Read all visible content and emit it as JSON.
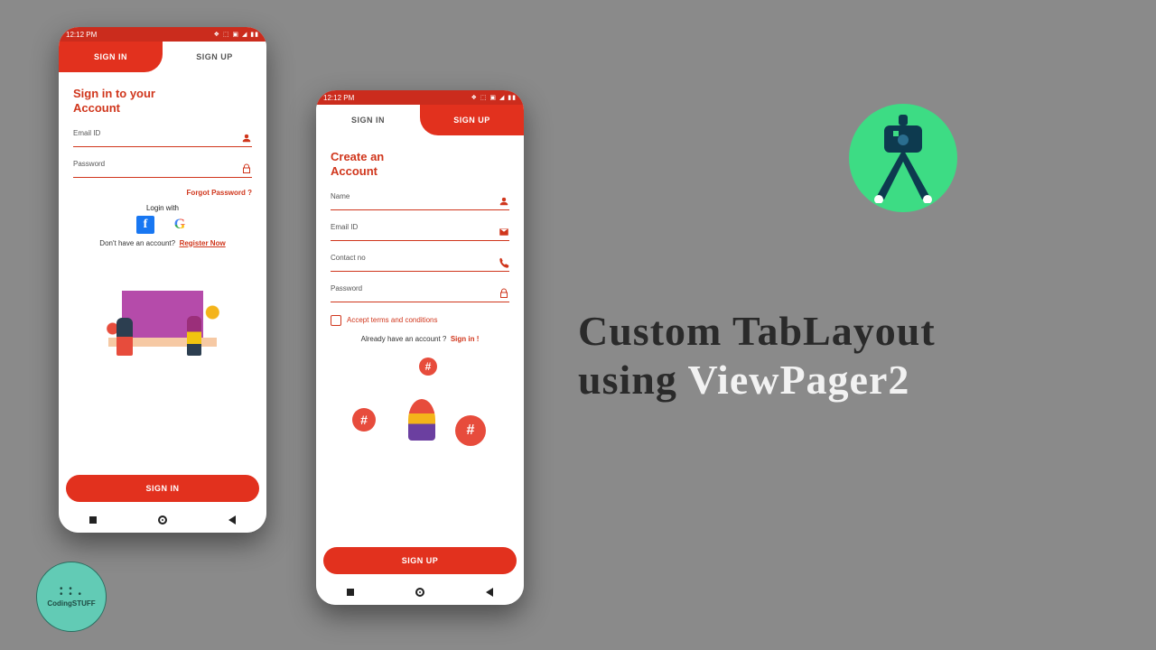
{
  "statusbar": {
    "time": "12:12 PM",
    "icons": "◆ ◉ ↕ ▲",
    "right": "❖ ⬚ ▣ ◢ ▮▮"
  },
  "tabs": {
    "signin": "SIGN IN",
    "signup": "SIGN UP"
  },
  "signin": {
    "title1": "Sign in to your",
    "title2": "Account",
    "email_label": "Email ID",
    "password_label": "Password",
    "forgot": "Forgot Password ?",
    "login_with": "Login with",
    "no_account": "Don't have an account?",
    "register": "Register Now",
    "cta": "SIGN IN"
  },
  "signup": {
    "title1": "Create an",
    "title2": "Account",
    "name_label": "Name",
    "email_label": "Email ID",
    "contact_label": "Contact no",
    "password_label": "Password",
    "terms": "Accept terms and conditions",
    "already": "Already have an account ?",
    "signin_link": "Sign in !",
    "cta": "SIGN UP"
  },
  "headline": {
    "line1a": "Custom TabLayout",
    "line2a": "using ",
    "line2b": "ViewPager2"
  },
  "channel": {
    "name": "CodingSTUFF"
  }
}
